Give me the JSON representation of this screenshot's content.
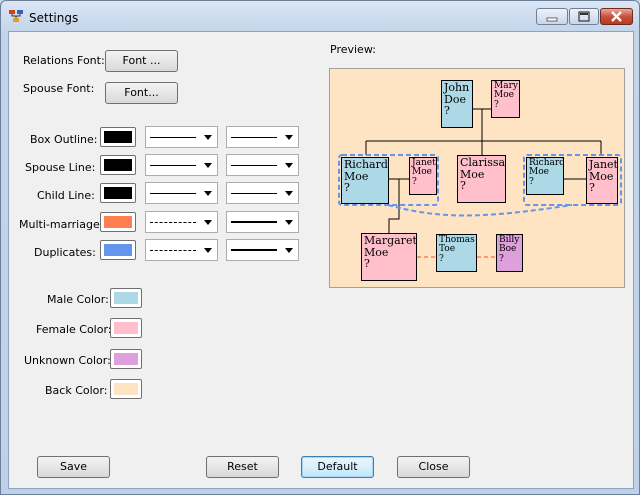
{
  "window": {
    "title": "Settings",
    "app_icon": "tree-icon"
  },
  "labels": {
    "relations_font": "Relations Font:",
    "spouse_font": "Spouse Font:",
    "box_outline": "Box Outline:",
    "spouse_line": "Spouse Line:",
    "child_line": "Child Line:",
    "multi_marriage": "Multi-marriage:",
    "duplicates": "Duplicates:",
    "male_color": "Male Color:",
    "female_color": "Female Color:",
    "unknown_color": "Unknown Color:",
    "back_color": "Back Color:",
    "preview": "Preview:"
  },
  "buttons": {
    "relations_font": "Font ...",
    "spouse_font": "Font...",
    "save": "Save",
    "reset": "Reset",
    "default": "Default",
    "close": "Close"
  },
  "colors": {
    "box_outline": "#000000",
    "spouse_line": "#000000",
    "child_line": "#000000",
    "multi_marriage": "#ff7f50",
    "duplicates": "#6495ed",
    "male": "#add8e6",
    "female": "#ffc0cb",
    "unknown": "#dda0dd",
    "back": "#ffe4c4"
  },
  "preview_nodes": {
    "john": {
      "line1": "John",
      "line2": "Doe",
      "line3": "?"
    },
    "mary": {
      "line1": "Mary",
      "line2": "Moe",
      "line3": "?"
    },
    "richard1": {
      "line1": "Richard",
      "line2": "Moe",
      "line3": "?"
    },
    "janet1": {
      "line1": "Janet",
      "line2": "Moe",
      "line3": "?"
    },
    "clarissa": {
      "line1": "Clarissa",
      "line2": "Moe",
      "line3": "?"
    },
    "richard2": {
      "line1": "Richard",
      "line2": "Moe",
      "line3": "?"
    },
    "janet2": {
      "line1": "Janet",
      "line2": "Moe",
      "line3": "?"
    },
    "margaret": {
      "line1": "Margaret",
      "line2": "Moe",
      "line3": "?"
    },
    "thomas": {
      "line1": "Thomas",
      "line2": "Toe",
      "line3": "?"
    },
    "billy": {
      "line1": "Billy",
      "line2": "Boe",
      "line3": "?"
    }
  }
}
